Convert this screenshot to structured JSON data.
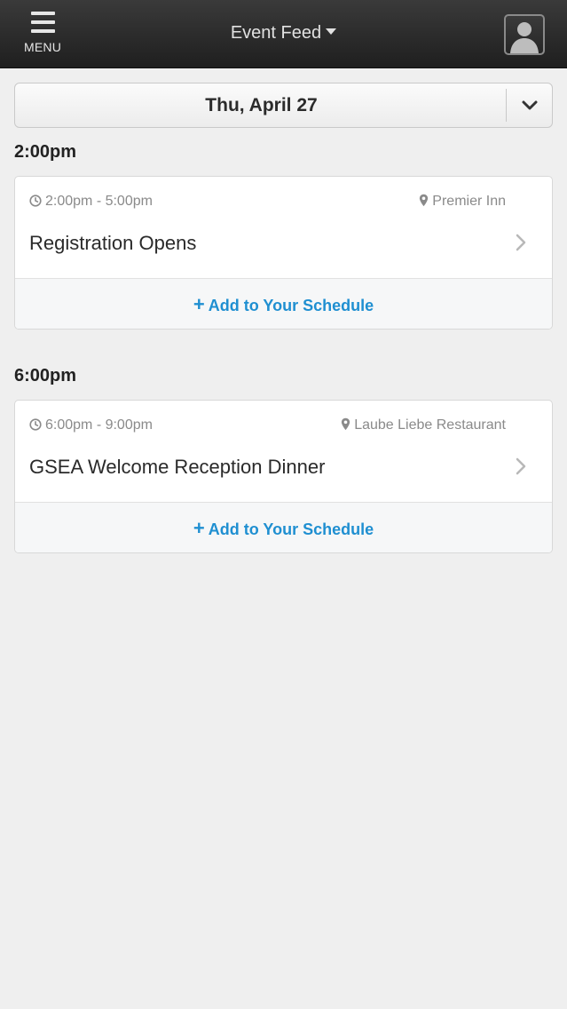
{
  "header": {
    "menu_label": "MENU",
    "title": "Event Feed"
  },
  "date_selector": {
    "label": "Thu, April 27"
  },
  "groups": [
    {
      "time": "2:00pm",
      "event": {
        "time_range": "2:00pm - 5:00pm",
        "location": "Premier Inn",
        "title": "Registration Opens",
        "add_plus": "+",
        "add_label": "Add to Your Schedule"
      }
    },
    {
      "time": "6:00pm",
      "event": {
        "time_range": "6:00pm - 9:00pm",
        "location": "Laube Liebe Restaurant",
        "title": "GSEA Welcome Reception Dinner",
        "add_plus": "+",
        "add_label": "Add to Your Schedule"
      }
    }
  ],
  "icons": {
    "menu": "hamburger-icon",
    "title_dropdown": "caret-down-icon",
    "avatar": "user-silhouette-icon",
    "date_dropdown": "chevron-down-icon",
    "time": "clock-icon",
    "location": "map-pin-icon",
    "open": "chevron-right-icon"
  },
  "colors": {
    "accent": "#1f8fd1",
    "topbar": "#2a2a2a",
    "background": "#efefef"
  }
}
